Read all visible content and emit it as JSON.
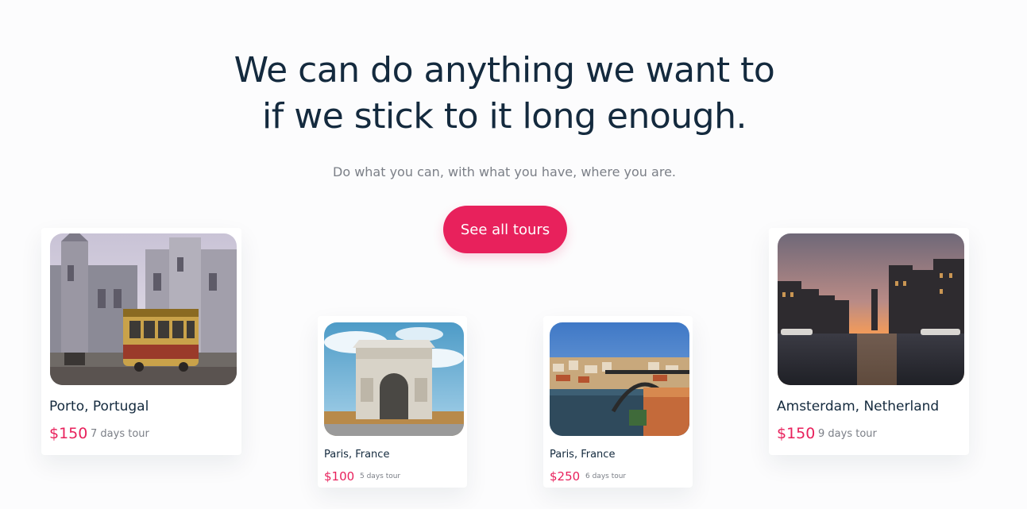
{
  "hero": {
    "headline_line1": "We can do anything we want to",
    "headline_line2": "if we stick to it long enough.",
    "subtitle": "Do what you can, with what you have, where you are.",
    "cta_label": "See all tours"
  },
  "colors": {
    "accent": "#e8215c",
    "heading": "#142a3e",
    "muted": "#7b7f87",
    "background": "#fcfcfd"
  },
  "tours": [
    {
      "city": "Porto, Portugal",
      "price": "$150",
      "duration": "7 days tour",
      "image": "porto-church-tram-photo"
    },
    {
      "city": "Paris, France",
      "price": "$100",
      "duration": "5 days tour",
      "image": "arc-de-triomphe-photo"
    },
    {
      "city": "Paris, France",
      "price": "$250",
      "duration": "6 days tour",
      "image": "river-bridge-city-photo"
    },
    {
      "city": "Amsterdam, Netherland",
      "price": "$150",
      "duration": "9 days tour",
      "image": "amsterdam-canal-sunset-photo"
    }
  ]
}
